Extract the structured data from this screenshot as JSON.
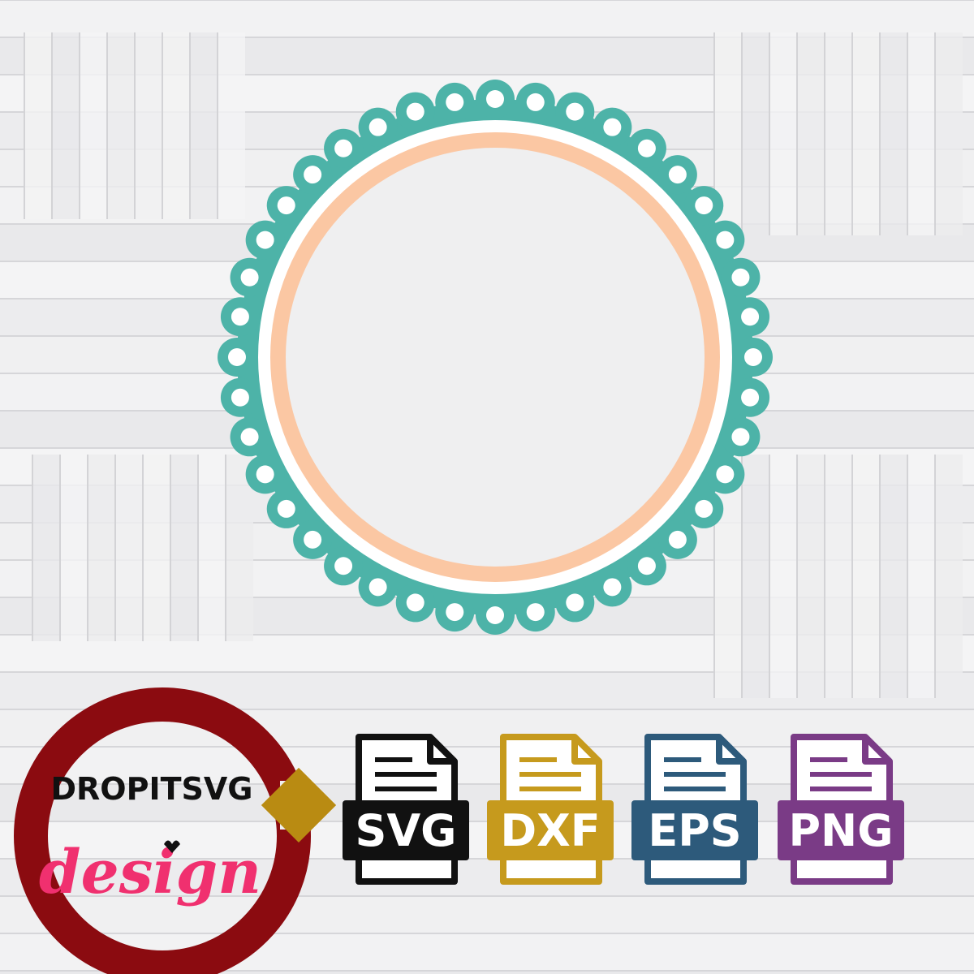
{
  "artwork": {
    "frame_color": "#4db3a8",
    "inner_ring_color": "#fbc7a3",
    "hole_color": "#ffffff",
    "scallop_count": 40
  },
  "brand": {
    "name": "DROPITSVG",
    "script_word": "design",
    "ring_color": "#8b0b10",
    "pointer_color": "#b98b12",
    "script_color": "#f0306f",
    "name_color": "#111111"
  },
  "formats": [
    {
      "label": "SVG",
      "color": "#111111",
      "icon": "file-icon"
    },
    {
      "label": "DXF",
      "color": "#c69a1d",
      "icon": "file-icon"
    },
    {
      "label": "EPS",
      "color": "#2d5a7b",
      "icon": "file-icon"
    },
    {
      "label": "PNG",
      "color": "#7a3b86",
      "icon": "file-icon"
    }
  ]
}
